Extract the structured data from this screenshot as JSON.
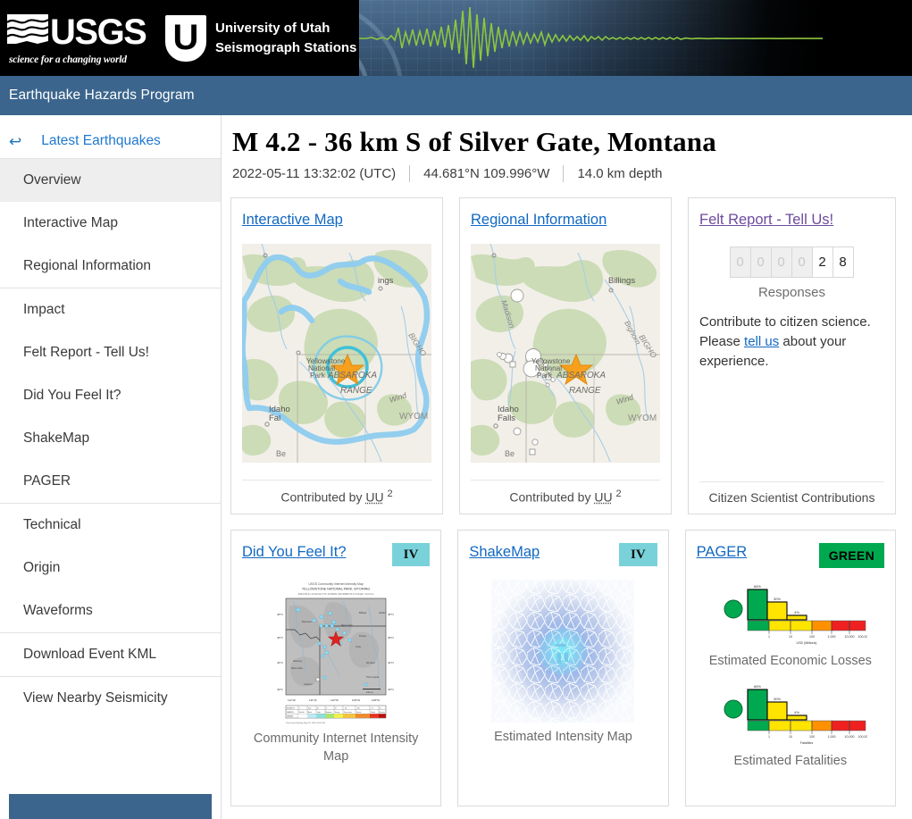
{
  "banner": {
    "usgs_word": "USGS",
    "usgs_tagline": "science for a changing world",
    "partner_line1": "University of Utah",
    "partner_line2": "Seismograph Stations",
    "seismogram_icon": "seismograph-waveform-icon"
  },
  "program_bar": {
    "title": "Earthquake Hazards Program"
  },
  "sidebar": {
    "back": {
      "label": "Latest Earthquakes",
      "icon": "arrow-left-icon"
    },
    "groups": [
      {
        "items": [
          {
            "label": "Overview",
            "active": true
          },
          {
            "label": "Interactive Map",
            "active": false
          },
          {
            "label": "Regional Information",
            "active": false
          }
        ]
      },
      {
        "items": [
          {
            "label": "Impact",
            "active": false
          },
          {
            "label": "Felt Report - Tell Us!",
            "active": false
          },
          {
            "label": "Did You Feel It?",
            "active": false
          },
          {
            "label": "ShakeMap",
            "active": false
          },
          {
            "label": "PAGER",
            "active": false
          }
        ]
      },
      {
        "items": [
          {
            "label": "Technical",
            "active": false
          },
          {
            "label": "Origin",
            "active": false
          },
          {
            "label": "Waveforms",
            "active": false
          }
        ]
      },
      {
        "items": [
          {
            "label": "Download Event KML",
            "active": false
          }
        ]
      },
      {
        "items": [
          {
            "label": "View Nearby Seismicity",
            "active": false
          }
        ]
      }
    ]
  },
  "event": {
    "title": "M 4.2 - 36 km S of Silver Gate, Montana",
    "time": "2022-05-11 13:32:02 (UTC)",
    "coords": "44.681°N 109.996°W",
    "depth": "14.0 km depth"
  },
  "cards": {
    "interactive_map": {
      "title": "Interactive Map",
      "footer_prefix": "Contributed by",
      "source": "UU",
      "source_sup": "2",
      "thumb_icon": "regional-terrain-map-icon",
      "map_labels": [
        "Billings",
        "Yellowstone National Park",
        "ABSAROKA",
        "RANGE",
        "Idaho Falls",
        "BIGHORN",
        "Wind",
        "WYOM",
        "Be"
      ]
    },
    "regional_information": {
      "title": "Regional Information",
      "footer_prefix": "Contributed by",
      "source": "UU",
      "source_sup": "2",
      "thumb_icon": "regional-seismicity-map-icon",
      "map_labels": [
        "Billings",
        "Madison",
        "Yellowstone National Park",
        "ABSAROKA",
        "RANGE",
        "Idaho Falls",
        "Bighorn",
        "BIGHOR",
        "Wind",
        "WYOM",
        "Be"
      ]
    },
    "felt_report": {
      "title": "Felt Report - Tell Us!",
      "visited": true,
      "digits": [
        "0",
        "0",
        "0",
        "0",
        "2",
        "8"
      ],
      "responses_label": "Responses",
      "body_part1": "Contribute to citizen science. Please",
      "body_link": "tell us",
      "body_part2": "about your experience.",
      "footer": "Citizen Scientist Contributions"
    },
    "did_you_feel_it": {
      "title": "Did You Feel It?",
      "badge": "IV",
      "badge_color": "#79d2da",
      "caption": "Community Internet Intensity Map",
      "thumb_icon": "cdi-intensity-map-icon",
      "thumb_header_line1": "USGS Community Internet Intensity Map",
      "thumb_header_line2": "YELLOWSTONE NATIONAL PARK, WYOMING",
      "thumb_lat_labels": [
        "46°N",
        "45°N",
        "44°N",
        "43°N"
      ],
      "thumb_lon_labels": [
        "112°W",
        "111°W",
        "110°W",
        "109°W",
        "108°W"
      ]
    },
    "shakemap": {
      "title": "ShakeMap",
      "badge": "IV",
      "badge_color": "#79d2da",
      "caption": "Estimated Intensity Map",
      "thumb_icon": "shakemap-intensity-map-icon"
    },
    "pager": {
      "title": "PAGER",
      "badge": "GREEN",
      "badge_color": "#00a94f",
      "blocks": [
        {
          "caption": "Estimated Economic Losses",
          "icon": "pager-loss-histogram-icon"
        },
        {
          "caption": "Estimated Fatalities",
          "icon": "pager-fatality-histogram-icon"
        }
      ]
    }
  },
  "chart_data": [
    {
      "type": "bar",
      "title": "Estimated Economic Losses",
      "xlabel": "USD (Millions)",
      "ylabel": "",
      "categories": [
        "1",
        "10",
        "100",
        "1,000",
        "10,000",
        "100,000"
      ],
      "bar_labels": [
        "66%",
        "30%",
        "4%"
      ],
      "values": [
        66,
        30,
        4,
        0,
        0,
        0
      ],
      "ylim": [
        0,
        100
      ],
      "grid": false,
      "legend": "none",
      "alert_level": "GREEN",
      "band_colors": [
        "#00a94f",
        "#ffe400",
        "#ffe400",
        "#ff9100",
        "#ef2020",
        "#ef2020"
      ]
    },
    {
      "type": "bar",
      "title": "Estimated Fatalities",
      "xlabel": "Fatalities",
      "ylabel": "",
      "categories": [
        "1",
        "10",
        "100",
        "1,000",
        "10,000",
        "100,000"
      ],
      "bar_labels": [
        "66%",
        "30%",
        "4%"
      ],
      "values": [
        66,
        30,
        4,
        0,
        0,
        0
      ],
      "ylim": [
        0,
        100
      ],
      "grid": false,
      "legend": "none",
      "alert_level": "GREEN",
      "band_colors": [
        "#00a94f",
        "#ffe400",
        "#ffe400",
        "#ff9100",
        "#ef2020",
        "#ef2020"
      ]
    }
  ]
}
